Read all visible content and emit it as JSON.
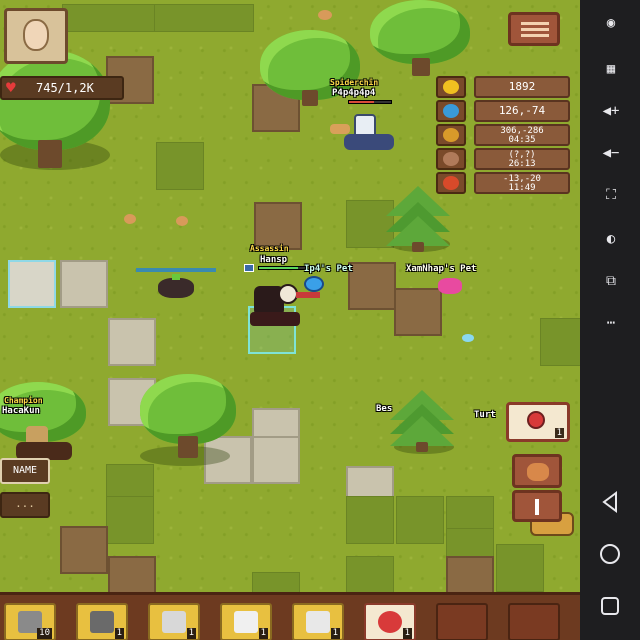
{
  "hud": {
    "hp_text": "745/1,2K"
  },
  "stats": [
    {
      "name": "gold",
      "icon": "gold-coin-icon",
      "color": "#f0c020",
      "line1": "1892",
      "line2": ""
    },
    {
      "name": "world",
      "icon": "globe-icon",
      "color": "#3a9ad8",
      "line1": "126,-74",
      "line2": ""
    },
    {
      "name": "position",
      "icon": "compass-icon",
      "color": "#d89a2a",
      "line1": "306,-286",
      "line2": "04:35"
    },
    {
      "name": "map",
      "icon": "map-icon",
      "color": "#b07a5a",
      "line1": "(?,?)",
      "line2": "26:13"
    },
    {
      "name": "event",
      "icon": "chest-icon",
      "color": "#d84a2a",
      "line1": "-13,-20",
      "line2": "11:49"
    }
  ],
  "players": {
    "top_player_guild": "Spiderchin",
    "top_player_name": "P4p4p4p4",
    "main_guild": "Assassin",
    "main_name": "Hansp",
    "pet1": "Ip4's Pet",
    "pet2": "XamNhap's Pet",
    "left_guild": "Champion",
    "left_name": "HacaKun",
    "npc_partial": "Bes",
    "npc_partial2": "Turt"
  },
  "buttons": {
    "name_label": "NAME",
    "chat_label": "..."
  },
  "potion_count": "1",
  "hotbar": [
    {
      "icon": "axe-icon",
      "count": "10",
      "kind": "tool"
    },
    {
      "icon": "helmet-icon",
      "count": "1",
      "kind": "tool"
    },
    {
      "icon": "sword-icon",
      "count": "1",
      "kind": "tool"
    },
    {
      "icon": "hat-icon",
      "count": "1",
      "kind": "tool"
    },
    {
      "icon": "bone-icon",
      "count": "1",
      "kind": "tool"
    },
    {
      "icon": "potion-icon",
      "count": "1",
      "kind": "potion"
    },
    {
      "icon": "empty-slot",
      "count": "",
      "kind": "empty"
    },
    {
      "icon": "empty-slot",
      "count": "",
      "kind": "empty"
    }
  ]
}
